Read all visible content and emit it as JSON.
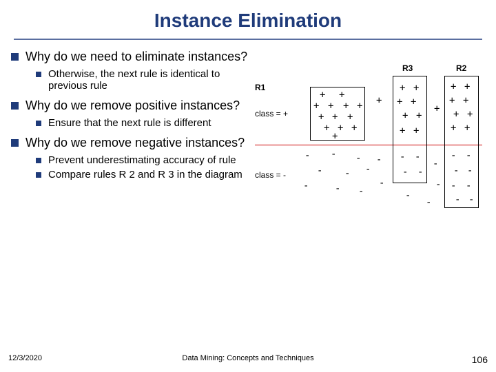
{
  "title": "Instance Elimination",
  "bullets": [
    {
      "text": "Why do we need to eliminate instances?",
      "sub": [
        {
          "text": "Otherwise, the next rule is identical to previous rule"
        }
      ]
    },
    {
      "text": "Why do we remove positive instances?",
      "sub": [
        {
          "text": "Ensure that the next rule is different"
        }
      ]
    },
    {
      "text": "Why do we remove negative instances?",
      "sub": [
        {
          "text": "Prevent underestimating accuracy of rule"
        },
        {
          "text": "Compare rules R 2 and R 3 in the diagram"
        }
      ]
    }
  ],
  "diagram": {
    "labels": {
      "r1": "R1",
      "r2": "R2",
      "r3": "R3",
      "class_pos": "class = +",
      "class_neg": "class = -"
    }
  },
  "footer": {
    "date": "12/3/2020",
    "center": "Data Mining: Concepts and Techniques",
    "page": "106"
  }
}
